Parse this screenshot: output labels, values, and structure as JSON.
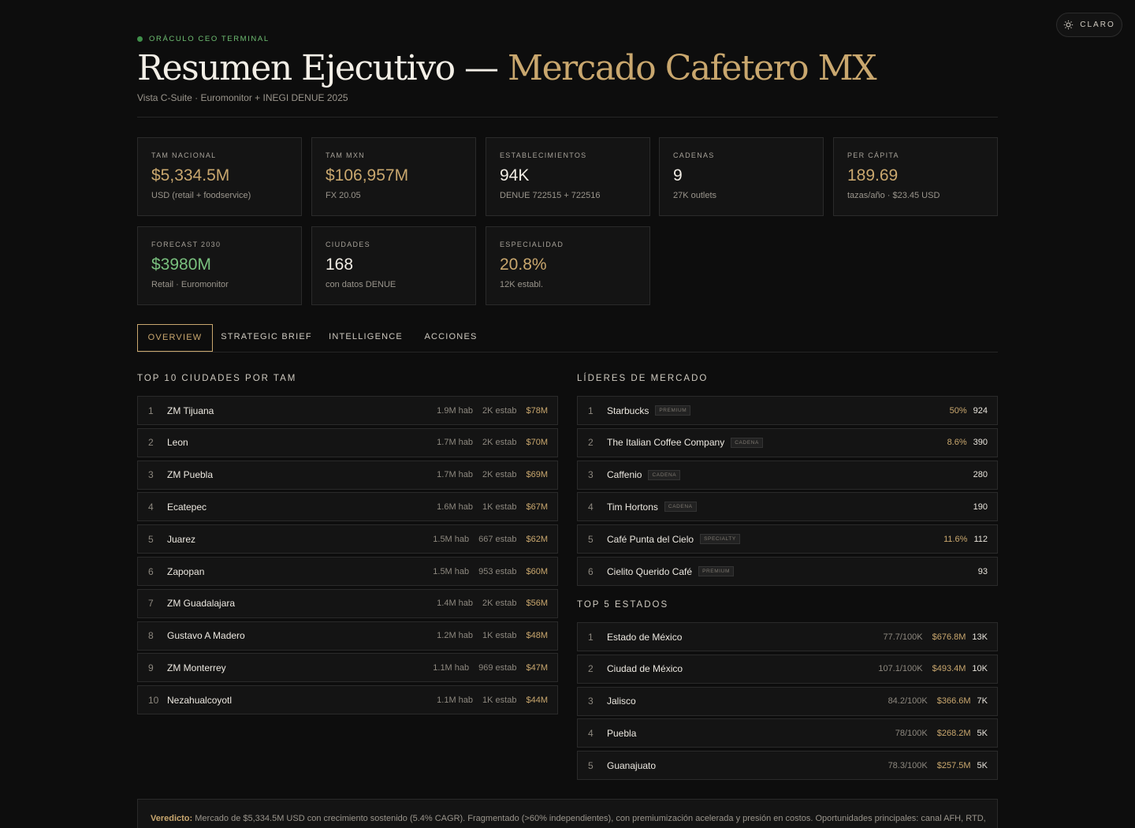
{
  "theme_toggle": {
    "label": "CLARO",
    "icon": "sun-icon"
  },
  "header": {
    "eyebrow": "ORÁCULO CEO TERMINAL",
    "title_main": "Resumen Ejecutivo —",
    "title_accent": "Mercado Cafetero MX",
    "subtitle": "Vista C-Suite · Euromonitor + INEGI DENUE 2025"
  },
  "kpis": [
    {
      "label": "TAM NACIONAL",
      "value": "$5,334.5M",
      "sub": "USD (retail + foodservice)"
    },
    {
      "label": "TAM MXN",
      "value": "$106,957M",
      "sub": "FX 20.05"
    },
    {
      "label": "ESTABLECIMIENTOS",
      "value": "94K",
      "sub": "DENUE 722515 + 722516"
    },
    {
      "label": "CADENAS",
      "value": "9",
      "sub": "27K outlets"
    },
    {
      "label": "PER CÁPITA",
      "value": "189.69",
      "sub": "tazas/año · $23.45 USD"
    },
    {
      "label": "FORECAST 2030",
      "value": "$3980M",
      "sub": "Retail · Euromonitor"
    },
    {
      "label": "CIUDADES",
      "value": "168",
      "sub": "con datos DENUE"
    },
    {
      "label": "ESPECIALIDAD",
      "value": "20.8%",
      "sub": "12K establ."
    }
  ],
  "tabs": [
    "OVERVIEW",
    "STRATEGIC BRIEF",
    "INTELLIGENCE",
    "ACCIONES"
  ],
  "cities": {
    "title": "TOP 10 CIUDADES POR TAM",
    "rows": [
      {
        "rank": "1",
        "name": "ZM Tijuana",
        "pop": "1.9M hab",
        "estab": "2K estab",
        "tam": "$78M"
      },
      {
        "rank": "2",
        "name": "Leon",
        "pop": "1.7M hab",
        "estab": "2K estab",
        "tam": "$70M"
      },
      {
        "rank": "3",
        "name": "ZM Puebla",
        "pop": "1.7M hab",
        "estab": "2K estab",
        "tam": "$69M"
      },
      {
        "rank": "4",
        "name": "Ecatepec",
        "pop": "1.6M hab",
        "estab": "1K estab",
        "tam": "$67M"
      },
      {
        "rank": "5",
        "name": "Juarez",
        "pop": "1.5M hab",
        "estab": "667 estab",
        "tam": "$62M"
      },
      {
        "rank": "6",
        "name": "Zapopan",
        "pop": "1.5M hab",
        "estab": "953 estab",
        "tam": "$60M"
      },
      {
        "rank": "7",
        "name": "ZM Guadalajara",
        "pop": "1.4M hab",
        "estab": "2K estab",
        "tam": "$56M"
      },
      {
        "rank": "8",
        "name": "Gustavo A Madero",
        "pop": "1.2M hab",
        "estab": "1K estab",
        "tam": "$48M"
      },
      {
        "rank": "9",
        "name": "ZM Monterrey",
        "pop": "1.1M hab",
        "estab": "969 estab",
        "tam": "$47M"
      },
      {
        "rank": "10",
        "name": "Nezahualcoyotl",
        "pop": "1.1M hab",
        "estab": "1K estab",
        "tam": "$44M"
      }
    ]
  },
  "leaders": {
    "title": "LÍDERES DE MERCADO",
    "rows": [
      {
        "rank": "1",
        "name": "Starbucks",
        "tag": "PREMIUM",
        "share": "50%",
        "count": "924"
      },
      {
        "rank": "2",
        "name": "The Italian Coffee Company",
        "tag": "CADENA",
        "share": "8.6%",
        "count": "390"
      },
      {
        "rank": "3",
        "name": "Caffenio",
        "tag": "CADENA",
        "share": "",
        "count": "280"
      },
      {
        "rank": "4",
        "name": "Tim Hortons",
        "tag": "CADENA",
        "share": "",
        "count": "190"
      },
      {
        "rank": "5",
        "name": "Café Punta del Cielo",
        "tag": "SPECIALTY",
        "share": "11.6%",
        "count": "112"
      },
      {
        "rank": "6",
        "name": "Cielito Querido Café",
        "tag": "PREMIUM",
        "share": "",
        "count": "93"
      }
    ]
  },
  "states": {
    "title": "TOP 5 ESTADOS",
    "rows": [
      {
        "rank": "1",
        "name": "Estado de México",
        "density": "77.7/100K",
        "tam": "$676.8M",
        "count": "13K"
      },
      {
        "rank": "2",
        "name": "Ciudad de México",
        "density": "107.1/100K",
        "tam": "$493.4M",
        "count": "10K"
      },
      {
        "rank": "3",
        "name": "Jalisco",
        "density": "84.2/100K",
        "tam": "$366.6M",
        "count": "7K"
      },
      {
        "rank": "4",
        "name": "Puebla",
        "density": "78/100K",
        "tam": "$268.2M",
        "count": "5K"
      },
      {
        "rank": "5",
        "name": "Guanajuato",
        "density": "78.3/100K",
        "tam": "$257.5M",
        "count": "5K"
      }
    ]
  },
  "verdict": {
    "label": "Veredicto:",
    "text": " Mercado de $5,334.5M USD con crecimiento sostenido (5.4% CAGR). Fragmentado (>60% independientes), con premiumización acelerada y presión en costos. Oportunidades principales: canal AFH, RTD,"
  },
  "colors": {
    "accent": "#c9a76e",
    "positive": "#79c07e",
    "background": "#0d0d0d"
  }
}
